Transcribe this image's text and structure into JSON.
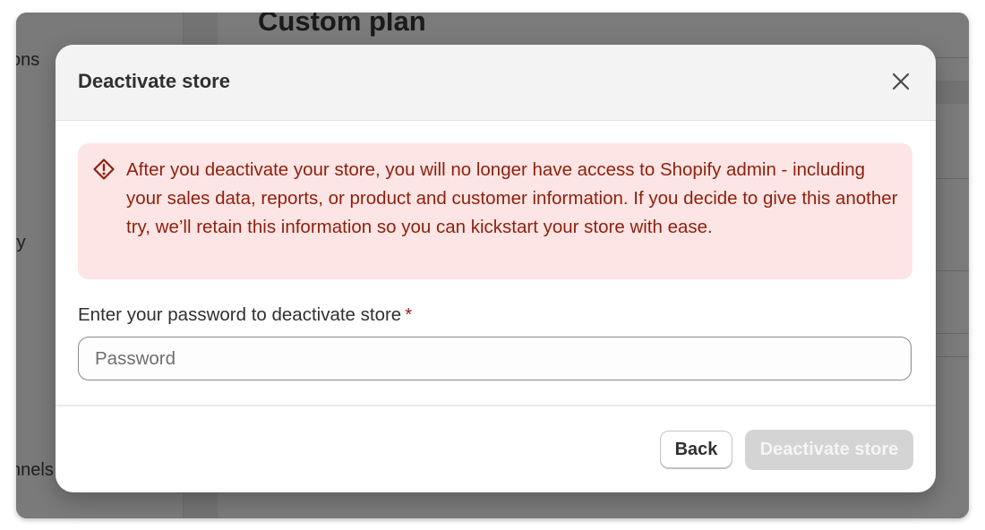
{
  "background": {
    "page_title": "Custom plan",
    "sidebar_fragments": [
      "ons",
      "ry",
      "nnels"
    ]
  },
  "modal": {
    "title": "Deactivate store",
    "close_icon": "close-icon",
    "warning": {
      "icon": "warning-diamond-icon",
      "text": "After you deactivate your store, you will no longer have access to Shopify admin - including your sales data, reports, or product and customer information. If you decide to give this another try, we’ll retain this information so you can kickstart your store with ease.",
      "color": "#8e1f0b",
      "background": "#fee5e5"
    },
    "password_field": {
      "label": "Enter your password to deactivate store",
      "required_marker": "*",
      "placeholder": "Password",
      "value": ""
    },
    "buttons": {
      "back_label": "Back",
      "deactivate_label": "Deactivate store",
      "deactivate_disabled": true
    }
  }
}
